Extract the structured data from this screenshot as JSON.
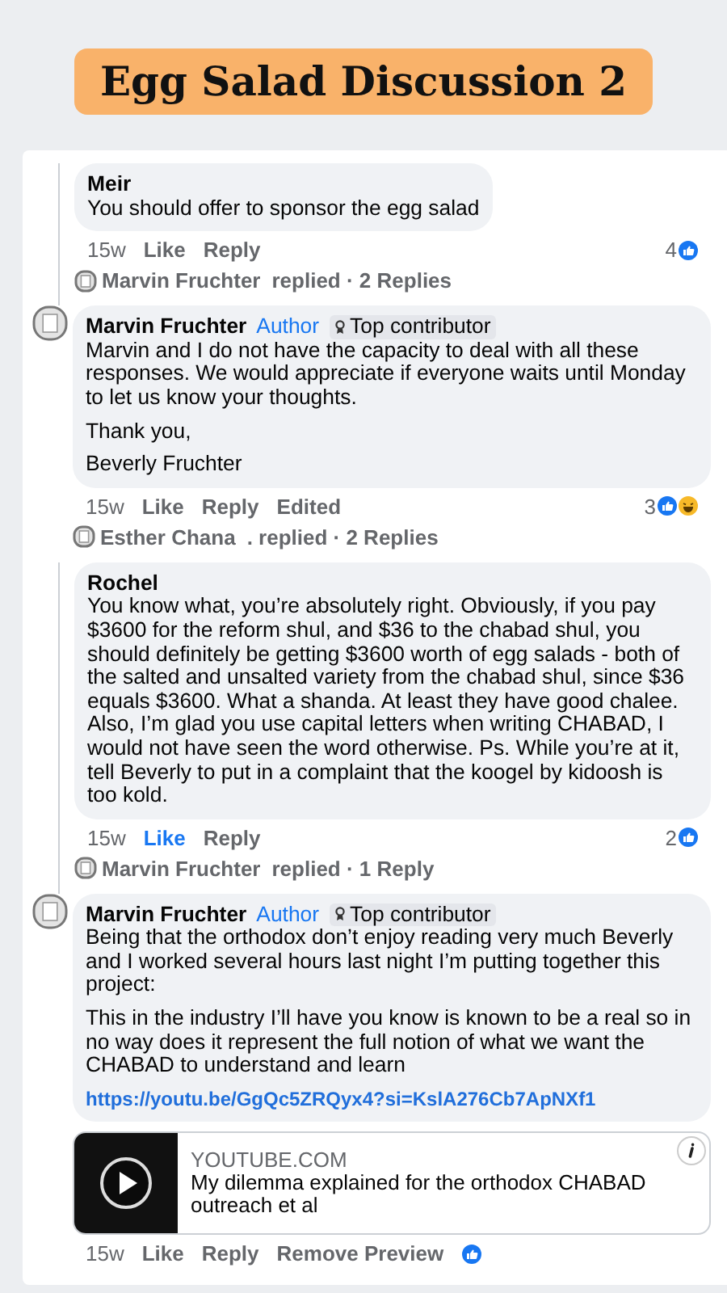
{
  "banner": {
    "title": "Egg Salad Discussion 2"
  },
  "comments": [
    {
      "kind": "reply",
      "author": "Meir",
      "paragraphs": [
        "You should offer to sponsor the egg salad"
      ],
      "time": "15w",
      "like": "Like",
      "liked": false,
      "reply": "Reply",
      "reactions": {
        "count": "4",
        "icons": [
          {
            "kind": "like"
          }
        ]
      },
      "replies": {
        "name": "Marvin Fruchter",
        "text": "replied · 2 Replies"
      }
    },
    {
      "kind": "top",
      "author": "Marvin Fruchter",
      "badges": [
        {
          "kind": "author",
          "label": "Author"
        },
        {
          "kind": "contributor",
          "label": "Top contributor"
        }
      ],
      "paragraphs": [
        "Marvin and I do not have the capacity to deal with all these responses. We would appreciate if everyone waits until Monday to let us know your thoughts.",
        "Thank you,",
        "Beverly Fruchter"
      ],
      "time": "15w",
      "like": "Like",
      "liked": false,
      "reply": "Reply",
      "extra": "Edited",
      "reactions": {
        "count": "3",
        "icons": [
          {
            "kind": "like"
          },
          {
            "kind": "haha"
          }
        ]
      },
      "replies": {
        "name": "Esther Chana",
        "text": ". replied · 2 Replies"
      }
    },
    {
      "kind": "reply",
      "author": "Rochel",
      "paragraphs": [
        "You know what, you’re absolutely right. Obviously, if you pay $3600 for the reform shul, and $36 to the chabad shul, you should definitely be getting $3600 worth of egg salads - both of the salted and unsalted variety from the chabad shul, since $36 equals $3600. What a shanda. At least they have good chalee. Also, I’m glad you use capital letters when writing CHABAD, I would not have seen the word otherwise. Ps. While you’re at it, tell Beverly to put in a complaint that the koogel by kidoosh is too kold."
      ],
      "time": "15w",
      "like": "Like",
      "liked": true,
      "reply": "Reply",
      "reactions": {
        "count": "2",
        "icons": [
          {
            "kind": "like"
          }
        ]
      },
      "replies": {
        "name": "Marvin Fruchter",
        "text": "replied · 1 Reply"
      }
    },
    {
      "kind": "top",
      "author": "Marvin Fruchter",
      "badges": [
        {
          "kind": "author",
          "label": "Author"
        },
        {
          "kind": "contributor",
          "label": "Top contributor"
        }
      ],
      "paragraphs": [
        "Being that the orthodox don’t enjoy reading very much Beverly and I worked several hours last night I’m putting together this project:",
        "This in the industry I’ll have you know is known to be a real so in no way does it represent the full notion of what we want the CHABAD to understand and learn"
      ],
      "link": "https://youtu.be/GgQc5ZRQyx4?si=KslA276Cb7ApNXf1",
      "preview": {
        "domain": "YOUTUBE.COM",
        "title": "My dilemma explained for the orthodox CHABAD outreach et al"
      },
      "time": "15w",
      "like": "Like",
      "liked": false,
      "reply": "Reply",
      "extra": "Remove Preview",
      "reactions": {
        "icons": [
          {
            "kind": "like"
          }
        ]
      }
    }
  ]
}
